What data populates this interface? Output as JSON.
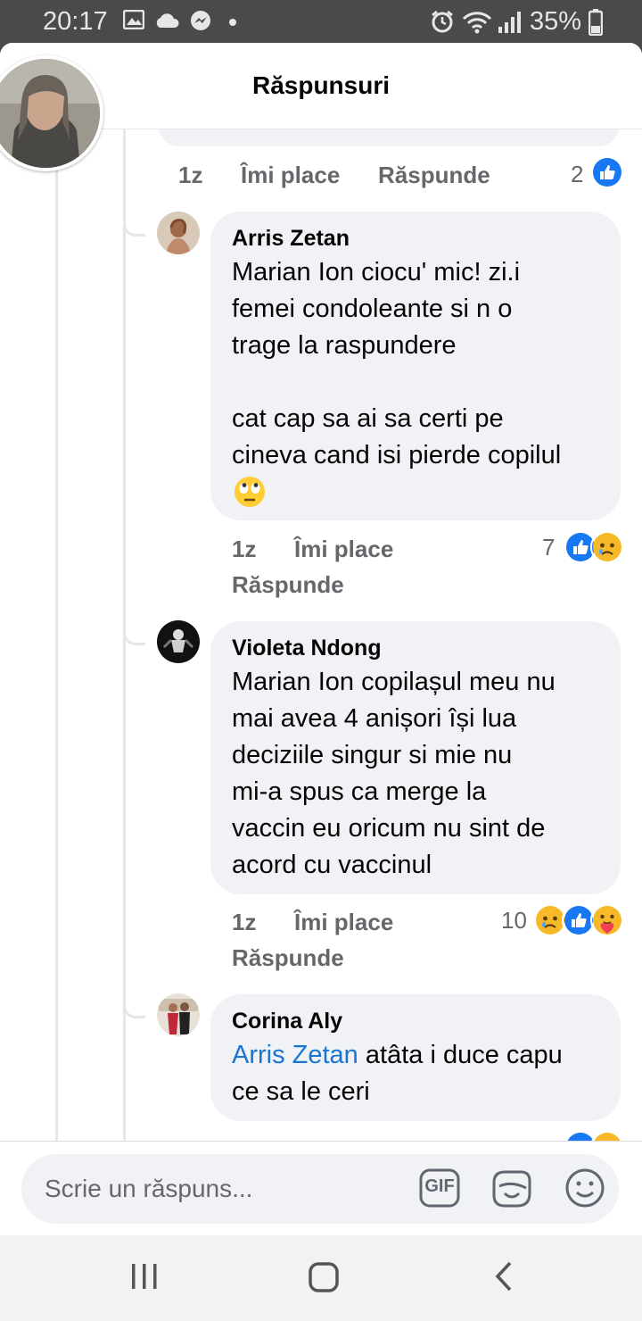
{
  "status_bar": {
    "time": "20:17",
    "battery": "35%",
    "icons": [
      "gallery-icon",
      "cloud-icon",
      "messenger-icon",
      "dot-icon",
      "alarm-icon",
      "wifi-icon",
      "signal-icon",
      "battery-icon"
    ]
  },
  "header": {
    "title": "Răspunsuri"
  },
  "top_comment": {
    "time": "1z",
    "like_label": "Îmi place",
    "reply_label": "Răspunde",
    "reaction_count": "2",
    "reactions": [
      "like"
    ]
  },
  "comments": [
    {
      "author": "Arris Zetan",
      "lines": [
        "Marian Ion ciocu' mic! zi.i",
        "femei condoleante si n o",
        "trage la raspundere",
        "",
        "cat cap sa ai sa certi pe",
        "cineva cand isi pierde copilul"
      ],
      "emoji": "eye-roll-emoji",
      "time": "1z",
      "like_label": "Îmi place",
      "reply_label": "Răspunde",
      "reaction_count": "7",
      "reactions": [
        "like",
        "sad"
      ]
    },
    {
      "author": "Violeta Ndong",
      "lines": [
        "Marian Ion copilașul meu nu",
        "mai avea 4 anișori își lua",
        "deciziile singur si mie nu",
        "mi-a spus ca merge la",
        "vaccin eu oricum nu sint de",
        "acord cu vaccinul"
      ],
      "time": "1z",
      "like_label": "Îmi place",
      "reply_label": "Răspunde",
      "reaction_count": "10",
      "reactions": [
        "sad",
        "like",
        "care"
      ]
    },
    {
      "author": "Corina Aly",
      "mention": "Arris Zetan",
      "line1_rest": " atâta i duce capu",
      "line2": "ce sa le ceri"
    }
  ],
  "composer": {
    "placeholder": "Scrie un răspuns...",
    "gif_label": "GIF"
  },
  "colors": {
    "like_blue": "#1877f2",
    "mention_blue": "#1876d2",
    "bubble": "#f0f2f5",
    "meta_gray": "#65676b"
  }
}
